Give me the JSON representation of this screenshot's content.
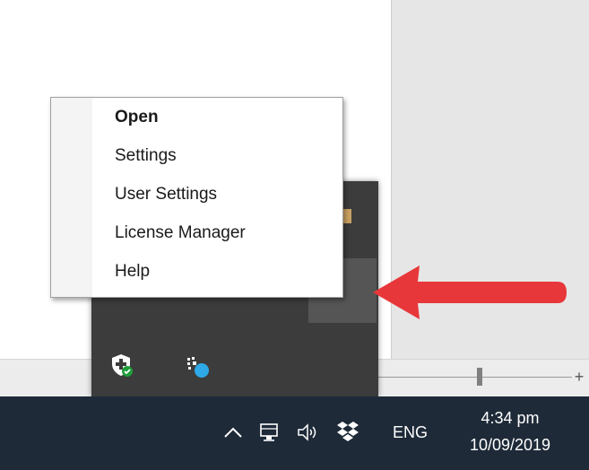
{
  "context_menu": {
    "items": [
      {
        "label": "Open",
        "bold": true
      },
      {
        "label": "Settings",
        "bold": false
      },
      {
        "label": "User Settings",
        "bold": false
      },
      {
        "label": "License Manager",
        "bold": false
      },
      {
        "label": "Help",
        "bold": false
      }
    ]
  },
  "tray_overflow": {
    "icons": [
      "windows-security-icon",
      "app-gear-badge-icon",
      "hidden-app-icon",
      "pointed-tray-icon"
    ]
  },
  "taskbar": {
    "language": "ENG",
    "time": "4:34 pm",
    "date": "10/09/2019",
    "icons": [
      "chevron-up-icon",
      "network-icon",
      "volume-icon",
      "dropbox-icon"
    ]
  },
  "annotation": {
    "arrow_color": "#e8373a"
  },
  "zoom": {
    "plus_label": "+"
  },
  "colors": {
    "taskbar_bg": "#1e2a38",
    "flyout_bg": "#3c3c3c",
    "menu_bg": "#ffffff"
  }
}
